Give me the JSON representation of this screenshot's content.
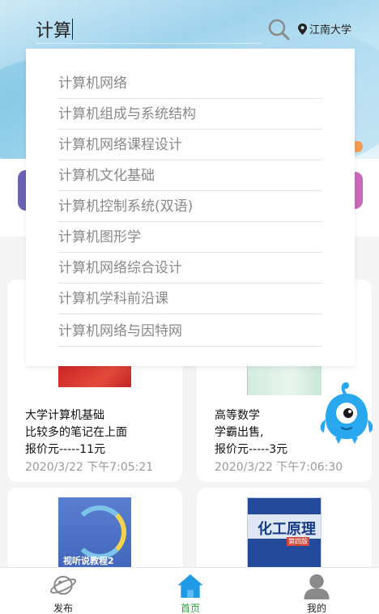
{
  "search": {
    "query": "计算",
    "location": "江南大学"
  },
  "suggestions": [
    "计算机网络",
    "计算机组成与系统结构",
    "计算机网络课程设计",
    "计算机文化基础",
    "计算机控制系统(双语)",
    "计算机图形学",
    "计算机网络综合设计",
    "计算机学科前沿课",
    "计算机网络与因特网"
  ],
  "listings": [
    {
      "title": "大学计算机基础",
      "desc": "比较多的笔记在上面",
      "price": "报价元-----11元",
      "time": "2020/3/22 下午7:05:21"
    },
    {
      "title": "高等数学",
      "desc": "学霸出售,",
      "price": "报价元-----3元",
      "time": "2020/3/22 下午7:06:30"
    },
    {
      "cover_title": "视听说教程2"
    },
    {
      "cover_title": "化工原理",
      "cover_badge": "第四版"
    }
  ],
  "tabbar": {
    "publish": "发布",
    "home": "首页",
    "mine": "我的"
  },
  "colors": {
    "accent_green": "#2f9a3a",
    "home_icon_blue": "#1f9ae6",
    "mascot_blue": "#29a8f0"
  },
  "icons": [
    "search-icon",
    "location-pin-icon",
    "planet-icon",
    "home-icon",
    "user-icon",
    "mascot-icon"
  ]
}
